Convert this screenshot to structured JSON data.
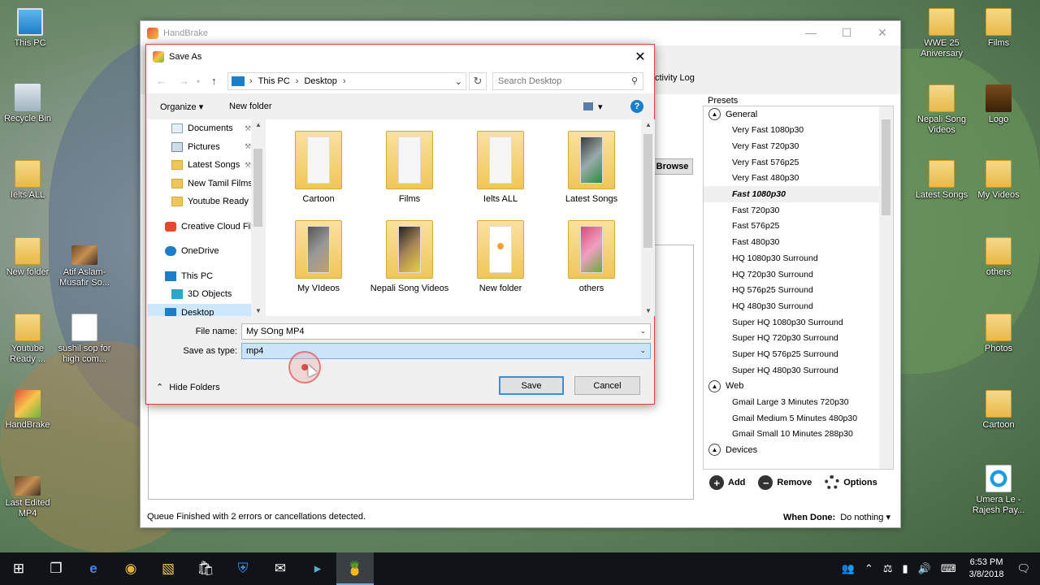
{
  "desktop_icons": [
    {
      "label": "This PC",
      "type": "pc"
    },
    {
      "label": "Recycle Bin",
      "type": "bin"
    },
    {
      "label": "Ielts ALL",
      "type": "folder"
    },
    {
      "label": "New folder",
      "type": "folder"
    },
    {
      "label": "Atif Aslam-Musafir So...",
      "type": "img"
    },
    {
      "label": "Youtube Ready ...",
      "type": "folder"
    },
    {
      "label": "sushil sop for high com...",
      "type": "doc"
    },
    {
      "label": "HandBrake",
      "type": "app"
    },
    {
      "label": "Last Edited MP4",
      "type": "img"
    },
    {
      "label": "WWE 25 Aniversary",
      "type": "folder"
    },
    {
      "label": "Films",
      "type": "folder"
    },
    {
      "label": "Nepali Song Videos",
      "type": "folder"
    },
    {
      "label": "Logo",
      "type": "logo"
    },
    {
      "label": "Latest Songs",
      "type": "folder"
    },
    {
      "label": "My Videos",
      "type": "folder"
    },
    {
      "label": "others",
      "type": "folder"
    },
    {
      "label": "Photos",
      "type": "folder"
    },
    {
      "label": "Cartoon",
      "type": "folder"
    },
    {
      "label": "Umera Le - Rajesh Pay...",
      "type": "cd"
    }
  ],
  "handbrake": {
    "title": "HandBrake",
    "activity_log": "ctivity Log",
    "browse": "Browse",
    "status": "Queue Finished with 2 errors or cancellations detected.",
    "when_done_label": "When Done:",
    "when_done_value": "Do nothing",
    "presets_label": "Presets",
    "groups": {
      "general": "General",
      "web": "Web",
      "devices": "Devices"
    },
    "general_items": [
      "Very Fast 1080p30",
      "Very Fast 720p30",
      "Very Fast 576p25",
      "Very Fast 480p30",
      "Fast 1080p30",
      "Fast 720p30",
      "Fast 576p25",
      "Fast 480p30",
      "HQ 1080p30 Surround",
      "HQ 720p30 Surround",
      "HQ 576p25 Surround",
      "HQ 480p30 Surround",
      "Super HQ 1080p30 Surround",
      "Super HQ 720p30 Surround",
      "Super HQ 576p25 Surround",
      "Super HQ 480p30 Surround"
    ],
    "selected_preset": "Fast 1080p30",
    "web_items": [
      "Gmail Large 3 Minutes 720p30",
      "Gmail Medium 5 Minutes 480p30",
      "Gmail Small 10 Minutes 288p30"
    ],
    "actions": {
      "add": "Add",
      "remove": "Remove",
      "options": "Options"
    }
  },
  "dialog": {
    "title": "Save As",
    "breadcrumb": [
      "This PC",
      "Desktop"
    ],
    "search_placeholder": "Search Desktop",
    "organize": "Organize",
    "new_folder": "New folder",
    "nav_items": [
      {
        "label": "Documents",
        "icon": "doc",
        "pinned": true
      },
      {
        "label": "Pictures",
        "icon": "pic",
        "pinned": true
      },
      {
        "label": "Latest Songs",
        "icon": "folder",
        "pinned": true
      },
      {
        "label": "New Tamil Films",
        "icon": "folder",
        "pinned": false
      },
      {
        "label": "Youtube Ready U",
        "icon": "folder",
        "pinned": false
      },
      {
        "label": "Creative Cloud Fil",
        "icon": "cc",
        "pinned": false
      },
      {
        "label": "OneDrive",
        "icon": "cloud",
        "pinned": false
      },
      {
        "label": "This PC",
        "icon": "pc",
        "pinned": false
      },
      {
        "label": "3D Objects",
        "icon": "3d",
        "pinned": false
      },
      {
        "label": "Desktop",
        "icon": "desk",
        "pinned": false
      }
    ],
    "folders": [
      {
        "label": "Cartoon",
        "thumb": "plain"
      },
      {
        "label": "Films",
        "thumb": "plain"
      },
      {
        "label": "Ielts ALL",
        "thumb": "plain"
      },
      {
        "label": "Latest Songs",
        "thumb": "dark"
      },
      {
        "label": "My VIdeos",
        "thumb": "gray"
      },
      {
        "label": "Nepali Song Videos",
        "thumb": "photo"
      },
      {
        "label": "New folder",
        "thumb": "orange"
      },
      {
        "label": "others",
        "thumb": "pink"
      }
    ],
    "file_name_label": "File name:",
    "file_name_value": "My SOng MP4",
    "save_type_label": "Save as type:",
    "save_type_value": "mp4",
    "hide_folders": "Hide Folders",
    "save": "Save",
    "cancel": "Cancel"
  },
  "taskbar": {
    "time": "6:53 PM",
    "date": "3/8/2018"
  }
}
